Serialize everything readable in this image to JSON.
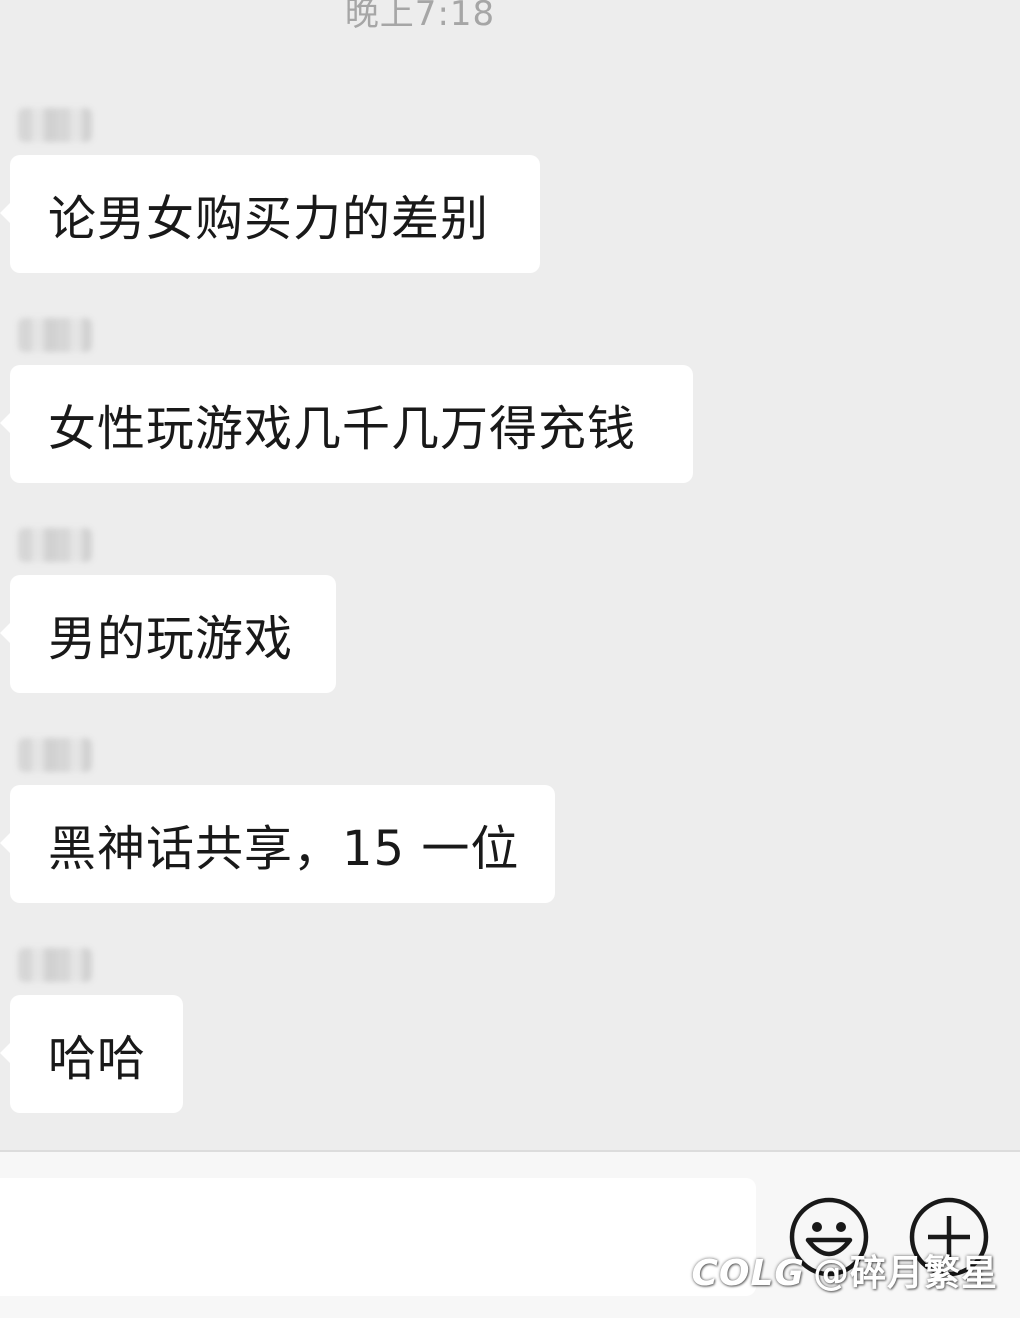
{
  "chat": {
    "timestamp": "晚上7:18",
    "messages": [
      {
        "text": "论男女购买力的差别"
      },
      {
        "text": "女性玩游戏几千几万得充钱"
      },
      {
        "text": "男的玩游戏"
      },
      {
        "text": "黑神话共享，15 一位"
      },
      {
        "text": "哈哈"
      }
    ]
  },
  "input_bar": {
    "input_value": "",
    "emoji_icon": "smiley-face-icon",
    "plus_icon": "plus-circle-icon"
  },
  "watermark": {
    "logo": "COLG",
    "handle": "@碎月繁星"
  },
  "colors": {
    "background": "#ededed",
    "bubble": "#ffffff",
    "text": "#191919",
    "timestamp": "#a6a6a6"
  }
}
